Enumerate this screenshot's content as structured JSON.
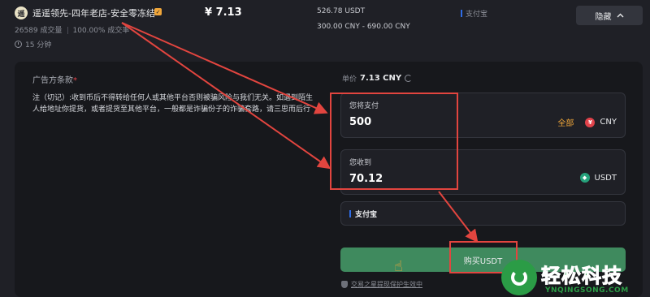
{
  "merchant": {
    "avatar": "遥",
    "name": "遥遥领先-四年老店-安全零冻结",
    "trades": "26589 成交量",
    "completion": "100.00% 成交率",
    "time": "15 分钟"
  },
  "price": "¥ 7.13",
  "available": "526.78 USDT",
  "limits": "300.00 CNY - 690.00 CNY",
  "pay_method_top": "支付宝",
  "hide_button": "隐藏",
  "terms": {
    "title": "广告方条款",
    "star": "*",
    "body": "注（切记）:收到币后不得转给任何人或其他平台否则被骗风险与我们无关。如遇到陌生人给地址你提货，或者提货至其他平台，一般都是诈骗份子的诈骗套路，请三思而后行"
  },
  "unit_price": {
    "label": "单价",
    "value": "7.13 CNY"
  },
  "pay_field": {
    "label": "您将支付",
    "value": "500",
    "all": "全部",
    "currency": "CNY",
    "coin_glyph": "¥"
  },
  "receive_field": {
    "label": "您收到",
    "value": "70.12",
    "currency": "USDT"
  },
  "payment_method": "支付宝",
  "buy_button": "购买USDT",
  "protection": "交易之星提现保护生效中",
  "watermark": {
    "text": "轻松科技",
    "sub": "YNQINGSONG.COM"
  },
  "colors": {
    "accent_green": "#3f8a5e",
    "annotation_red": "#e2453f",
    "highlight_orange": "#f0a63a"
  }
}
